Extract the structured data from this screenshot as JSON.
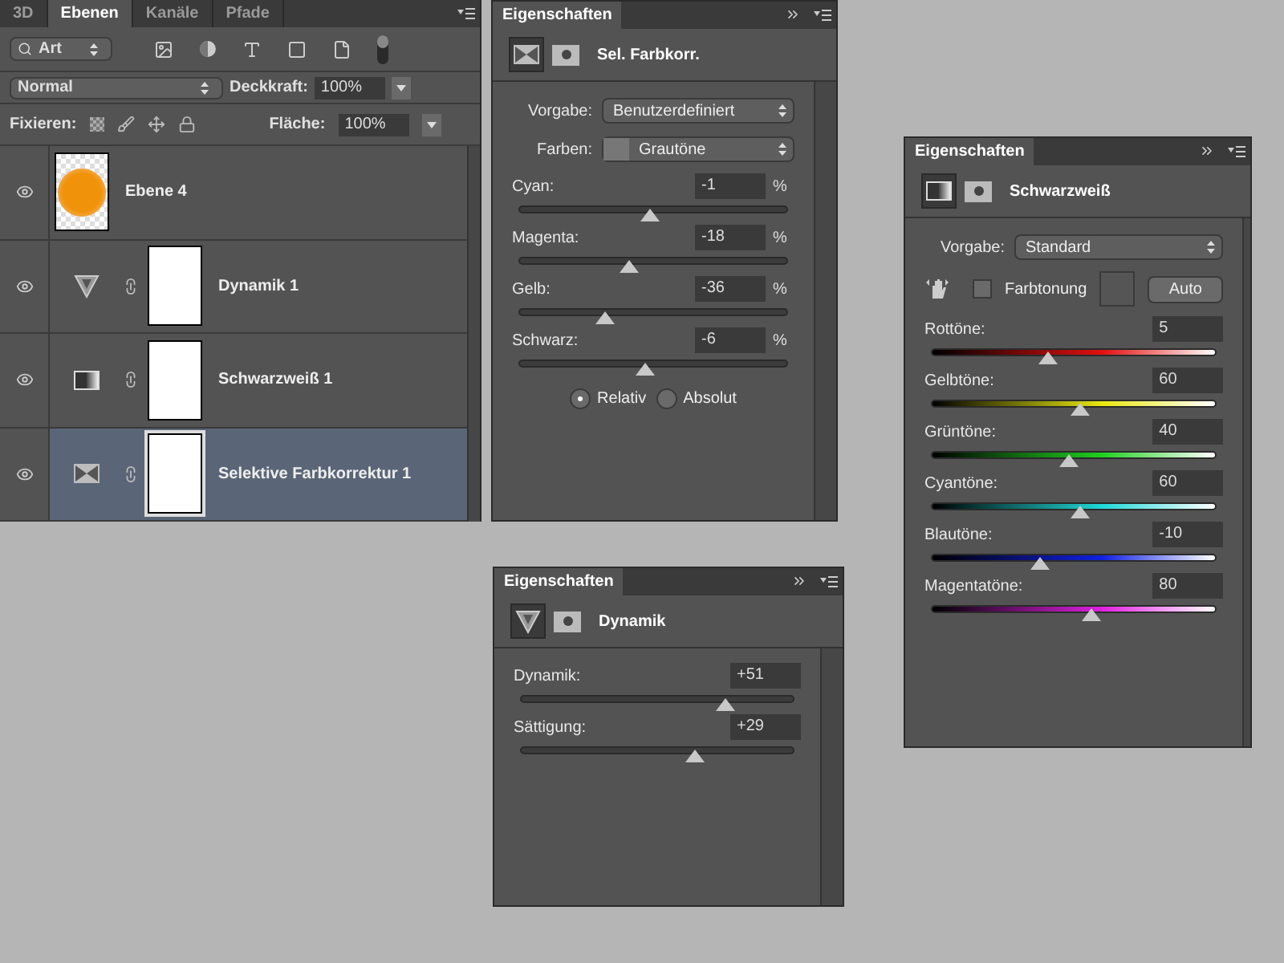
{
  "layers_panel": {
    "tabs": [
      {
        "label": "3D",
        "selected": false
      },
      {
        "label": "Ebenen",
        "selected": true
      },
      {
        "label": "Kanäle",
        "selected": false
      },
      {
        "label": "Pfade",
        "selected": false
      }
    ],
    "filter": "Art",
    "blend_mode": "Normal",
    "opacity_label": "Deckkraft:",
    "opacity": "100%",
    "lock_label": "Fixieren:",
    "fill_label": "Fläche:",
    "fill": "100%",
    "layers": [
      {
        "name": "Ebene 4",
        "kind": "pixel",
        "selected": false
      },
      {
        "name": "Dynamik 1",
        "kind": "vibrance",
        "selected": false
      },
      {
        "name": "Schwarzweiß 1",
        "kind": "blackwhite",
        "selected": false
      },
      {
        "name": "Selektive Farbkorrektur 1",
        "kind": "selective",
        "selected": true
      }
    ]
  },
  "selective_color_panel": {
    "tab": "Eigenschaften",
    "title": "Sel. Farbkorr.",
    "kind": "selective",
    "preset_label": "Vorgabe:",
    "preset": "Benutzerdefiniert",
    "colors_label": "Farben:",
    "colors": "Grautöne",
    "sliders": [
      {
        "label": "Cyan:",
        "value": "-1",
        "unit": "%",
        "level": 0.49
      },
      {
        "label": "Magenta:",
        "value": "-18",
        "unit": "%",
        "level": 0.41
      },
      {
        "label": "Gelb:",
        "value": "-36",
        "unit": "%",
        "level": 0.32
      },
      {
        "label": "Schwarz:",
        "value": "-6",
        "unit": "%",
        "level": 0.47
      }
    ],
    "modes": [
      {
        "label": "Relativ",
        "selected": true
      },
      {
        "label": "Absolut",
        "selected": false
      }
    ]
  },
  "vibrance_panel": {
    "tab": "Eigenschaften",
    "title": "Dynamik",
    "kind": "vibrance",
    "sliders": [
      {
        "label": "Dynamik:",
        "value": "+51",
        "level": 0.75
      },
      {
        "label": "Sättigung:",
        "value": "+29",
        "level": 0.64
      }
    ]
  },
  "blackwhite_panel": {
    "tab": "Eigenschaften",
    "title": "Schwarzweiß",
    "kind": "blackwhite",
    "preset_label": "Vorgabe:",
    "preset": "Standard",
    "tint": {
      "label": "Farbtonung",
      "checked": false
    },
    "auto_button": "Auto",
    "sliders": [
      {
        "label": "Rottöne:",
        "value": "5",
        "level": 0.41,
        "kind": "red"
      },
      {
        "label": "Gelbtöne:",
        "value": "60",
        "level": 0.52,
        "kind": "yellow"
      },
      {
        "label": "Grüntöne:",
        "value": "40",
        "level": 0.48,
        "kind": "green"
      },
      {
        "label": "Cyantöne:",
        "value": "60",
        "level": 0.52,
        "kind": "cyan"
      },
      {
        "label": "Blautöne:",
        "value": "-10",
        "level": 0.38,
        "kind": "blue"
      },
      {
        "label": "Magentatöne:",
        "value": "80",
        "level": 0.56,
        "kind": "magenta"
      }
    ]
  }
}
